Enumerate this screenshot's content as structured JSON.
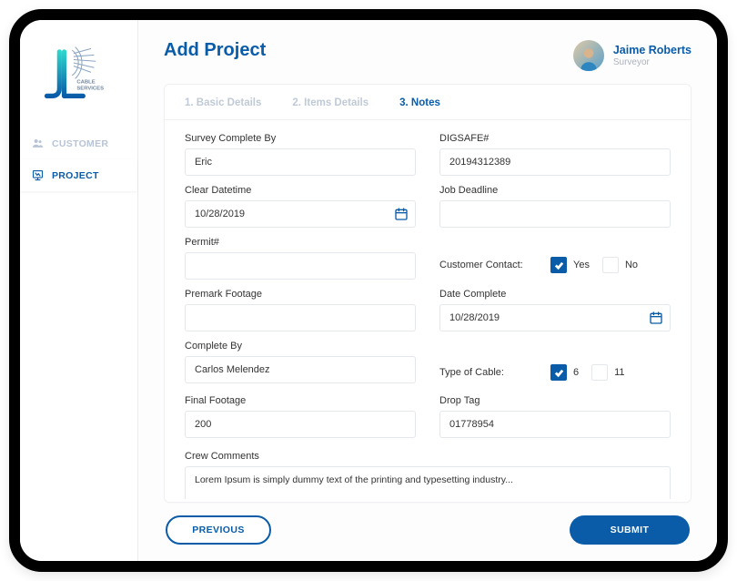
{
  "brand": "CABLE SERVICES",
  "nav": {
    "items": [
      {
        "label": "CUSTOMER",
        "active": false
      },
      {
        "label": "PROJECT",
        "active": true
      }
    ]
  },
  "header": {
    "title": "Add Project",
    "user": {
      "name": "Jaime Roberts",
      "role": "Surveyor"
    }
  },
  "tabs": [
    {
      "label": "1. Basic Details",
      "active": false
    },
    {
      "label": "2. Items Details",
      "active": false
    },
    {
      "label": "3. Notes",
      "active": true
    }
  ],
  "form": {
    "survey_complete_by": {
      "label": "Survey Complete By",
      "value": "Eric"
    },
    "digsafe": {
      "label": "DIGSAFE#",
      "value": "20194312389"
    },
    "clear_datetime": {
      "label": "Clear Datetime",
      "value": "10/28/2019"
    },
    "job_deadline": {
      "label": "Job Deadline",
      "value": ""
    },
    "permit": {
      "label": "Permit#",
      "value": ""
    },
    "customer_contact": {
      "label": "Customer Contact:",
      "yes": "Yes",
      "no": "No",
      "value": "Yes"
    },
    "premark_footage": {
      "label": "Premark Footage",
      "value": ""
    },
    "date_complete": {
      "label": "Date Complete",
      "value": "10/28/2019"
    },
    "complete_by": {
      "label": "Complete By",
      "value": "Carlos Melendez"
    },
    "type_of_cable": {
      "label": "Type of Cable:",
      "opt1": "6",
      "opt2": "11",
      "value": "6"
    },
    "final_footage": {
      "label": "Final Footage",
      "value": "200"
    },
    "drop_tag": {
      "label": "Drop Tag",
      "value": "01778954"
    },
    "crew_comments": {
      "label": "Crew Comments",
      "value": "Lorem Ipsum is simply dummy text of the printing and typesetting industry..."
    }
  },
  "actions": {
    "previous": "PREVIOUS",
    "submit": "SUBMIT"
  }
}
